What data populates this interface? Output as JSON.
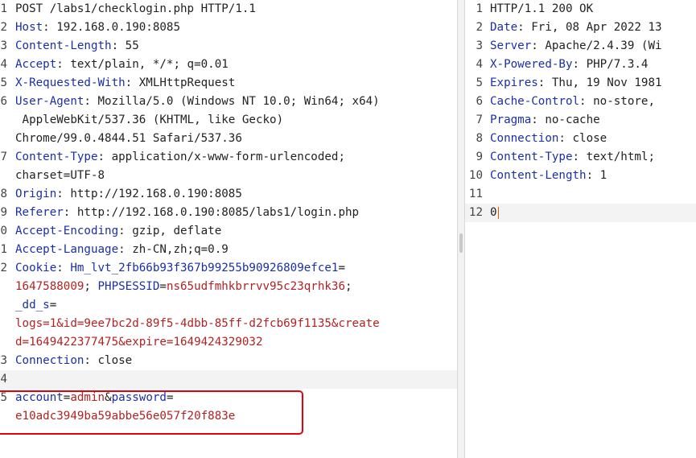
{
  "request": {
    "lines": [
      {
        "num": "1",
        "parts": [
          {
            "t": "POST /labs1/checklogin.php HTTP/1.1",
            "c": ""
          }
        ]
      },
      {
        "num": "2",
        "parts": [
          {
            "t": "Host",
            "c": "hk"
          },
          {
            "t": ": 192.168.0.190:8085",
            "c": ""
          }
        ]
      },
      {
        "num": "3",
        "parts": [
          {
            "t": "Content-Length",
            "c": "hk"
          },
          {
            "t": ": 55",
            "c": ""
          }
        ]
      },
      {
        "num": "4",
        "parts": [
          {
            "t": "Accept",
            "c": "hk"
          },
          {
            "t": ": text/plain, */*; q=0.01",
            "c": ""
          }
        ]
      },
      {
        "num": "5",
        "parts": [
          {
            "t": "X-Requested-With",
            "c": "hk"
          },
          {
            "t": ": XMLHttpRequest",
            "c": ""
          }
        ]
      },
      {
        "num": "6",
        "parts": [
          {
            "t": "User-Agent",
            "c": "hk"
          },
          {
            "t": ": Mozilla/5.0 (Windows NT 10.0; Win64; x64)",
            "c": ""
          }
        ]
      },
      {
        "num": "",
        "parts": [
          {
            "t": " AppleWebKit/537.36 (KHTML, like Gecko)",
            "c": ""
          }
        ]
      },
      {
        "num": "",
        "parts": [
          {
            "t": "Chrome/99.0.4844.51 Safari/537.36",
            "c": ""
          }
        ]
      },
      {
        "num": "7",
        "parts": [
          {
            "t": "Content-Type",
            "c": "hk"
          },
          {
            "t": ": application/x-www-form-urlencoded;",
            "c": ""
          }
        ]
      },
      {
        "num": "",
        "parts": [
          {
            "t": "charset=UTF-8",
            "c": ""
          }
        ]
      },
      {
        "num": "8",
        "parts": [
          {
            "t": "Origin",
            "c": "hk"
          },
          {
            "t": ": http://192.168.0.190:8085",
            "c": ""
          }
        ]
      },
      {
        "num": "9",
        "parts": [
          {
            "t": "Referer",
            "c": "hk"
          },
          {
            "t": ": http://192.168.0.190:8085/labs1/login.php",
            "c": ""
          }
        ]
      },
      {
        "num": "0",
        "parts": [
          {
            "t": "Accept-Encoding",
            "c": "hk"
          },
          {
            "t": ": gzip, deflate",
            "c": ""
          }
        ]
      },
      {
        "num": "1",
        "parts": [
          {
            "t": "Accept-Language",
            "c": "hk"
          },
          {
            "t": ": zh-CN,zh;q=0.9",
            "c": ""
          }
        ]
      },
      {
        "num": "2",
        "parts": [
          {
            "t": "Cookie",
            "c": "hk"
          },
          {
            "t": ": ",
            "c": ""
          },
          {
            "t": "Hm_lvt_2fb66b93f367b99255b90926809efce1",
            "c": "ck"
          },
          {
            "t": "=",
            "c": ""
          }
        ]
      },
      {
        "num": "",
        "parts": [
          {
            "t": "1647588009",
            "c": "cv"
          },
          {
            "t": "; ",
            "c": ""
          },
          {
            "t": "PHPSESSID",
            "c": "ck"
          },
          {
            "t": "=",
            "c": ""
          },
          {
            "t": "ns65udfmhkbrrvv95c23qrhk36",
            "c": "cv"
          },
          {
            "t": ";",
            "c": ""
          }
        ]
      },
      {
        "num": "",
        "parts": [
          {
            "t": "_dd_s",
            "c": "ck"
          },
          {
            "t": "=",
            "c": ""
          }
        ]
      },
      {
        "num": "",
        "parts": [
          {
            "t": "logs=1&id=9ee7bc2d-89f5-4dbb-85ff-d2fcb69f1135&create",
            "c": "cv"
          }
        ]
      },
      {
        "num": "",
        "parts": [
          {
            "t": "d=1649422377475&expire=1649424329032",
            "c": "cv"
          }
        ]
      },
      {
        "num": "3",
        "parts": [
          {
            "t": "Connection",
            "c": "hk"
          },
          {
            "t": ": close",
            "c": ""
          }
        ]
      },
      {
        "num": "4",
        "parts": [
          {
            "t": "",
            "c": ""
          }
        ],
        "cur": true
      },
      {
        "num": "5",
        "parts": [
          {
            "t": "account",
            "c": "pk"
          },
          {
            "t": "=",
            "c": ""
          },
          {
            "t": "admin",
            "c": "pv"
          },
          {
            "t": "&",
            "c": ""
          },
          {
            "t": "password",
            "c": "pk"
          },
          {
            "t": "=",
            "c": ""
          }
        ]
      },
      {
        "num": "",
        "parts": [
          {
            "t": "e10adc3949ba59abbe56e057f20f883e",
            "c": "pv"
          }
        ]
      }
    ]
  },
  "response": {
    "lines": [
      {
        "num": "1",
        "parts": [
          {
            "t": "HTTP/1.1 200 OK",
            "c": ""
          }
        ]
      },
      {
        "num": "2",
        "parts": [
          {
            "t": "Date",
            "c": "hk"
          },
          {
            "t": ": Fri, 08 Apr 2022 13",
            "c": ""
          }
        ]
      },
      {
        "num": "3",
        "parts": [
          {
            "t": "Server",
            "c": "hk"
          },
          {
            "t": ": Apache/2.4.39 (Wi",
            "c": ""
          }
        ]
      },
      {
        "num": "4",
        "parts": [
          {
            "t": "X-Powered-By",
            "c": "hk"
          },
          {
            "t": ": PHP/7.3.4",
            "c": ""
          }
        ]
      },
      {
        "num": "5",
        "parts": [
          {
            "t": "Expires",
            "c": "hk"
          },
          {
            "t": ": Thu, 19 Nov 1981",
            "c": ""
          }
        ]
      },
      {
        "num": "6",
        "parts": [
          {
            "t": "Cache-Control",
            "c": "hk"
          },
          {
            "t": ": no-store,",
            "c": ""
          }
        ]
      },
      {
        "num": "7",
        "parts": [
          {
            "t": "Pragma",
            "c": "hk"
          },
          {
            "t": ": no-cache",
            "c": ""
          }
        ]
      },
      {
        "num": "8",
        "parts": [
          {
            "t": "Connection",
            "c": "hk"
          },
          {
            "t": ": close",
            "c": ""
          }
        ]
      },
      {
        "num": "9",
        "parts": [
          {
            "t": "Content-Type",
            "c": "hk"
          },
          {
            "t": ": text/html;",
            "c": ""
          }
        ]
      },
      {
        "num": "10",
        "parts": [
          {
            "t": "Content-Length",
            "c": "hk"
          },
          {
            "t": ": 1",
            "c": ""
          }
        ]
      },
      {
        "num": "11",
        "parts": [
          {
            "t": "",
            "c": ""
          }
        ]
      },
      {
        "num": "12",
        "parts": [
          {
            "t": "0",
            "c": ""
          }
        ],
        "cur": true,
        "caret": true
      }
    ]
  },
  "colors": {
    "header_key": "#1a2fa8",
    "cookie_value": "#b22222",
    "highlight_border": "#e8000b",
    "caret": "#e55a00"
  }
}
